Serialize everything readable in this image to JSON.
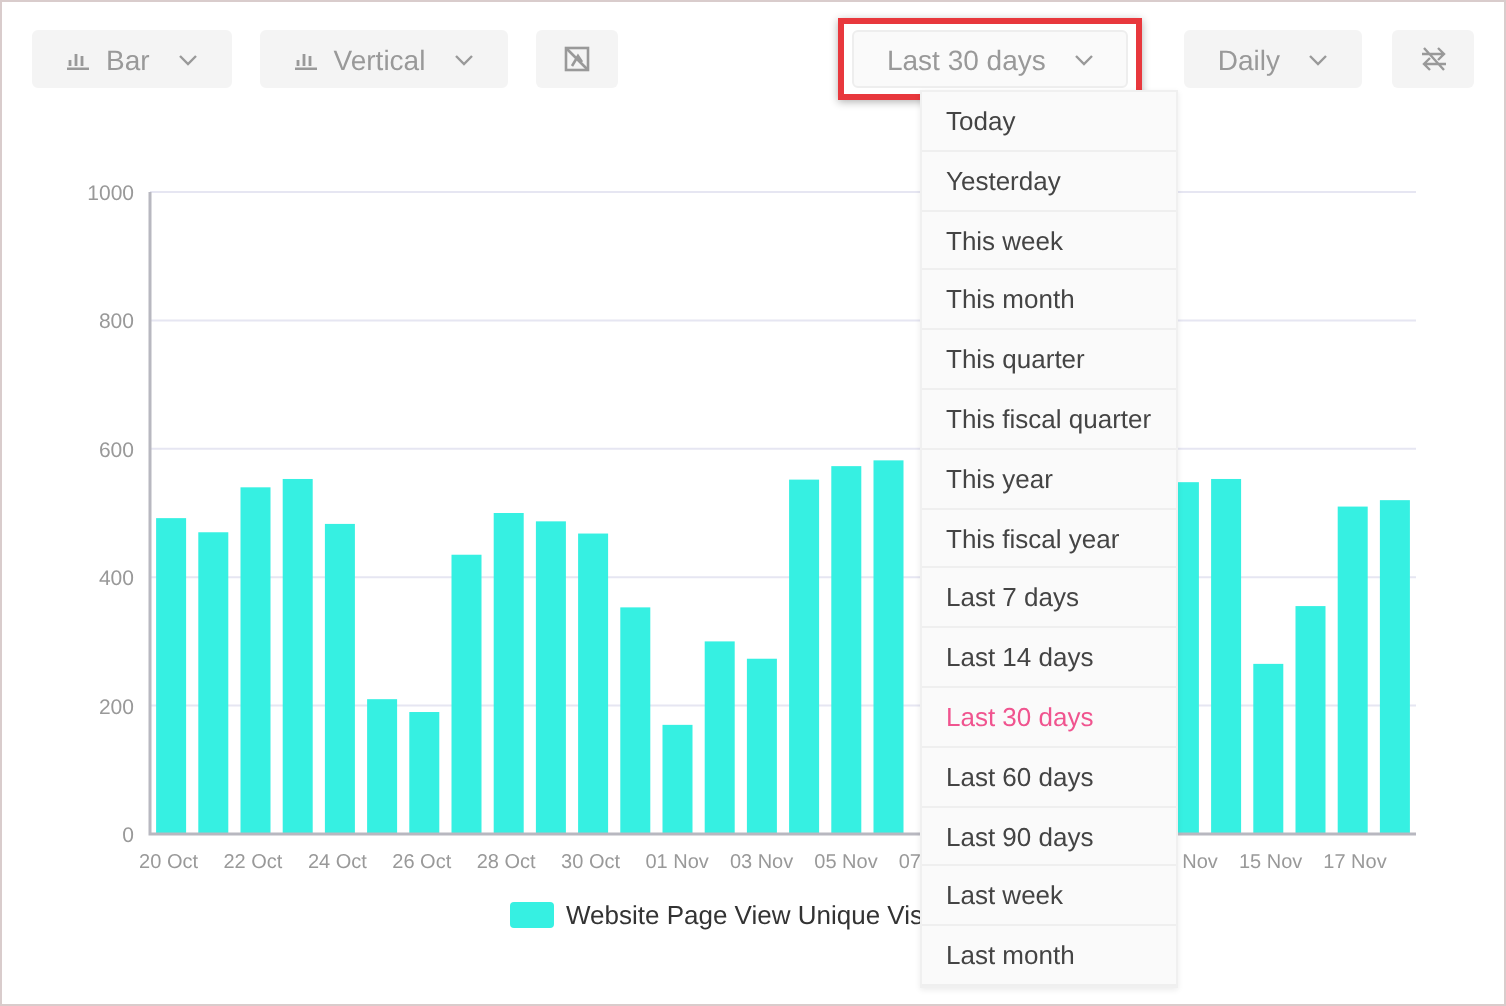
{
  "toolbar": {
    "chart_type": {
      "label": "Bar"
    },
    "orientation": {
      "label": "Vertical"
    },
    "date_range": {
      "label": "Last 30 days",
      "highlighted": true,
      "expanded": true
    },
    "interval": {
      "label": "Daily"
    }
  },
  "date_menu": [
    {
      "label": "Today",
      "selected": false
    },
    {
      "label": "Yesterday",
      "selected": false
    },
    {
      "label": "This week",
      "selected": false
    },
    {
      "label": "This month",
      "selected": false
    },
    {
      "label": "This quarter",
      "selected": false
    },
    {
      "label": "This fiscal quarter",
      "selected": false
    },
    {
      "label": "This year",
      "selected": false
    },
    {
      "label": "This fiscal year",
      "selected": false
    },
    {
      "label": "Last 7 days",
      "selected": false
    },
    {
      "label": "Last 14 days",
      "selected": false
    },
    {
      "label": "Last 30 days",
      "selected": true
    },
    {
      "label": "Last 60 days",
      "selected": false
    },
    {
      "label": "Last 90 days",
      "selected": false
    },
    {
      "label": "Last week",
      "selected": false
    },
    {
      "label": "Last month",
      "selected": false
    }
  ],
  "chart": {
    "chart_data": {
      "type": "bar",
      "orientation": "vertical",
      "categories": [
        "20 Oct",
        null,
        "22 Oct",
        null,
        "24 Oct",
        null,
        "26 Oct",
        null,
        "28 Oct",
        null,
        "30 Oct",
        null,
        "01 Nov",
        null,
        "03 Nov",
        null,
        "05 Nov",
        null,
        "07",
        null,
        null,
        null,
        null,
        null,
        "Nov",
        null,
        "15 Nov",
        null,
        "17 Nov",
        null
      ],
      "series": [
        {
          "name": "Website Page View Unique Vis",
          "color": "#36f0e2",
          "values": [
            492,
            470,
            540,
            553,
            483,
            210,
            190,
            435,
            500,
            487,
            468,
            353,
            170,
            300,
            273,
            552,
            573,
            582,
            null,
            null,
            null,
            null,
            null,
            null,
            548,
            553,
            265,
            355,
            510,
            520
          ]
        }
      ],
      "ylim": [
        0,
        1000
      ],
      "grid": true,
      "yticks": [
        0,
        200,
        400,
        600,
        800,
        1000
      ]
    }
  }
}
